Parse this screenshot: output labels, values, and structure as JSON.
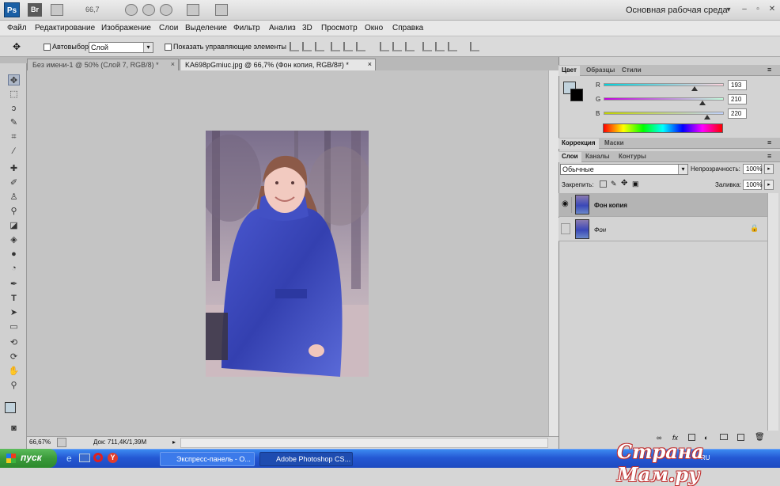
{
  "appbar": {
    "logo": "Ps",
    "bridge": "Br",
    "zoom": "66,7",
    "workspace": "Основная рабочая среда",
    "workspace_arrow": "▾",
    "win_minimize": "–",
    "win_restore": "▫",
    "win_close": "✕"
  },
  "menu": [
    "Файл",
    "Редактирование",
    "Изображение",
    "Слои",
    "Выделение",
    "Фильтр",
    "Анализ",
    "3D",
    "Просмотр",
    "Окно",
    "Справка"
  ],
  "options": {
    "autoselect_label": "Автовыбор:",
    "autoselect_value": "Слой",
    "show_controls_label": "Показать управляющие элементы"
  },
  "documents": {
    "tab1": "Без имени-1 @ 50% (Слой 7, RGB/8) *",
    "tab2": "KA698pGmiuc.jpg @ 66,7% (Фон копия, RGB/8#) *",
    "close": "×"
  },
  "status": {
    "zoom": "66,67%",
    "doc": "Док: 711,4K/1,39M"
  },
  "color_panel": {
    "tabs": [
      "Цвет",
      "Образцы",
      "Стили"
    ],
    "r_label": "R",
    "g_label": "G",
    "b_label": "B",
    "r": "193",
    "g": "210",
    "b": "220",
    "r_level": 0.757,
    "g_level": 0.824,
    "b_level": 0.863,
    "foreground": "#c1d2dc",
    "background": "#000000"
  },
  "adjust_panel": {
    "tabs": [
      "Коррекция",
      "Маски"
    ]
  },
  "layers_panel": {
    "tabs": [
      "Слои",
      "Каналы",
      "Контуры"
    ],
    "blend_mode": "Обычные",
    "opacity_label": "Непрозрачность:",
    "opacity": "100%",
    "lock_label": "Закрепить:",
    "fill_label": "Заливка:",
    "fill": "100%",
    "layers": [
      {
        "name": "Фон копия"
      },
      {
        "name": "Фон"
      }
    ]
  },
  "taskbar": {
    "start": "пуск",
    "items": [
      "Экспресс-панель - О...",
      "Adobe Photoshop CS..."
    ],
    "lang": "RU"
  },
  "watermark": "Страна Мам.ру",
  "colors": {
    "accent_ps": "#1a5fa5",
    "jacket": "#3a4cc0",
    "taskbar": "#2458d4"
  }
}
